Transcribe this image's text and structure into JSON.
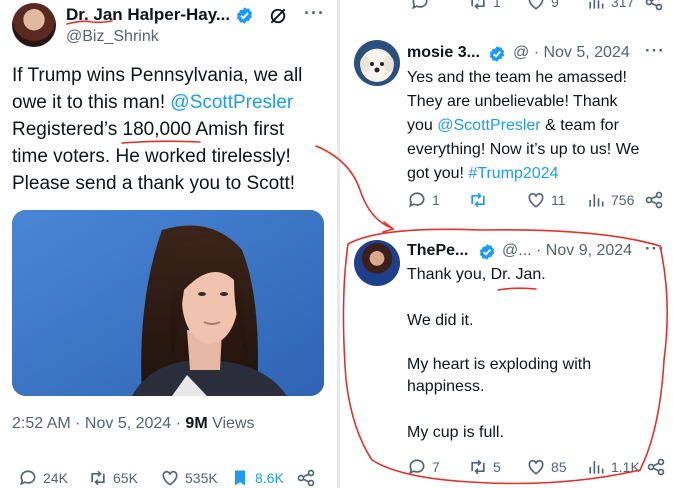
{
  "left_tweet": {
    "author_name": "Dr. Jan Halper-Hay...",
    "author_handle": "@Biz_Shrink",
    "more": "···",
    "text_parts": {
      "line1": "If Trump wins Pennsylvania, we all",
      "line2a": "owe it to this man! ",
      "mention": "@ScottPresler",
      "line3": "Registered’s 180,000 Amish first",
      "line4": "time voters. He worked tirelessly!",
      "line5": "Please send a thank you to Scott!"
    },
    "time": "2:52 AM · Nov 5, 2024 · ",
    "views_count": "9M",
    "views_label": " Views",
    "actions": {
      "replies": "24K",
      "reposts": "65K",
      "likes": "535K",
      "bookmarks": "8.6K"
    }
  },
  "right_partial": {
    "reposts": "1",
    "likes": "9",
    "views": "317"
  },
  "reply_1": {
    "author_name": "mosie 3...",
    "handle_date": "@ · Nov 5, 2024",
    "more": "···",
    "lines": {
      "l1": "Yes and the team he amassed!",
      "l2": "They are unbelievable!  Thank",
      "l3a": "you ",
      "mention": "@ScottPresler",
      "l3b": " & team for",
      "l4": "everything! Now it’s up to us! We",
      "l5a": "got you! ",
      "hashtag": "#Trump2024"
    },
    "actions": {
      "replies": "1",
      "reposts": "",
      "likes": "11",
      "views": "756"
    }
  },
  "reply_2": {
    "author_name": "ThePe...",
    "handle_date": "@... · Nov 9, 2024",
    "more": "···",
    "lines": {
      "l1": "Thank you, Dr. Jan.",
      "l2": "We did it.",
      "l3": "My heart is exploding with",
      "l4": "happiness.",
      "l5": "My cup is full."
    },
    "actions": {
      "replies": "7",
      "reposts": "5",
      "likes": "85",
      "views": "1.1K"
    }
  },
  "colors": {
    "accent": "#1d9bf0",
    "muted": "#536471",
    "text": "#0f1419",
    "annotation": "#e0322b"
  }
}
